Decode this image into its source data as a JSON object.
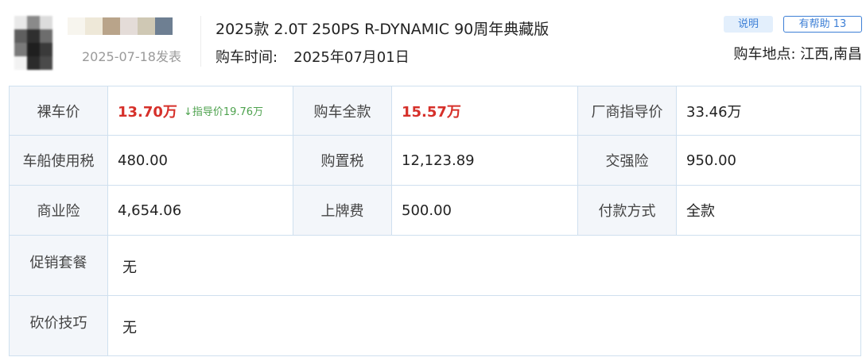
{
  "header": {
    "post_date": "2025-07-18发表",
    "car_model": "2025款 2.0T 250PS R-DYNAMIC 90周年典藏版",
    "buy_time_label": "购车时间:",
    "buy_time_value": "2025年07月01日",
    "explain_label": "说明",
    "helpful_label": "有帮助 13",
    "location_label": "购车地点:",
    "location_value": "江西,南昌"
  },
  "price_table": {
    "bare_price_label": "裸车价",
    "bare_price_value": "13.70万",
    "guide_price_note": "↓指导价19.76万",
    "total_price_label": "购车全款",
    "total_price_value": "15.57万",
    "msrp_label": "厂商指导价",
    "msrp_value": "33.46万",
    "vessel_tax_label": "车船使用税",
    "vessel_tax_value": "480.00",
    "purchase_tax_label": "购置税",
    "purchase_tax_value": "12,123.89",
    "compulsory_ins_label": "交强险",
    "compulsory_ins_value": "950.00",
    "commercial_ins_label": "商业险",
    "commercial_ins_value": "4,654.06",
    "plate_fee_label": "上牌费",
    "plate_fee_value": "500.00",
    "payment_label": "付款方式",
    "payment_value": "全款",
    "promo_label": "促销套餐",
    "promo_value": "无",
    "bargain_label": "砍价技巧",
    "bargain_value": "无"
  },
  "colors": {
    "accent_red": "#d6302a",
    "accent_green": "#4ea24e",
    "link_blue": "#3d7fd6",
    "label_bg": "#f3f6fa",
    "border": "#cfe0ef"
  }
}
